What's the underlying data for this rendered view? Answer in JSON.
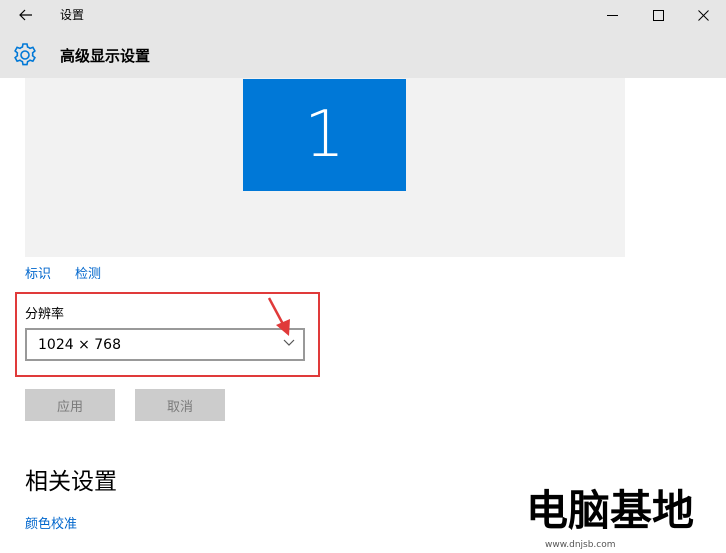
{
  "window": {
    "title": "设置"
  },
  "header": {
    "title": "高级显示设置"
  },
  "display_preview": {
    "monitor_label": "1"
  },
  "links": {
    "identify": "标识",
    "detect": "检测"
  },
  "resolution": {
    "label": "分辨率",
    "selected": "1024 × 768"
  },
  "buttons": {
    "apply": "应用",
    "cancel": "取消"
  },
  "related": {
    "title": "相关设置",
    "color_calibration": "颜色校准"
  },
  "watermark": {
    "text": "电脑基地",
    "url": "www.dnjsb.com"
  },
  "colors": {
    "accent": "#0078d7",
    "link": "#0066cc",
    "highlight_box": "#e03a3a",
    "titlebar": "#e6e6e6"
  }
}
